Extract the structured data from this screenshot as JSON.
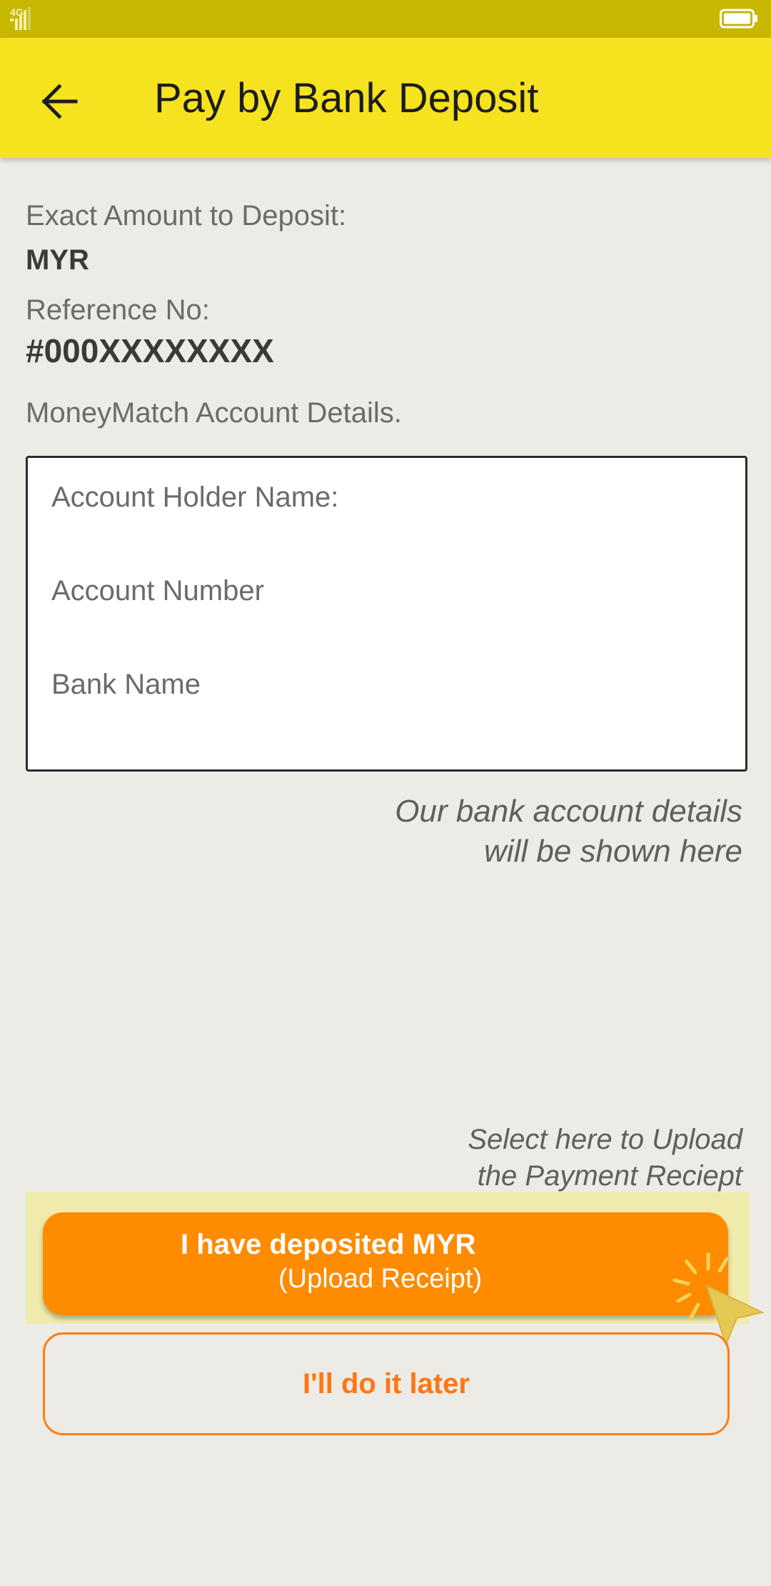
{
  "status_bar": {
    "network_label": "4G",
    "signal_icon": "signal-icon",
    "battery_icon": "battery-icon"
  },
  "header": {
    "back_icon": "arrow-left-icon",
    "title": "Pay by Bank Deposit"
  },
  "deposit": {
    "amount_label": "Exact Amount to Deposit:",
    "amount_value": "MYR",
    "reference_label": "Reference No:",
    "reference_value": "#000XXXXXXXX",
    "account_section_label": "MoneyMatch Account Details."
  },
  "account_box": {
    "holder_name_label": "Account Holder Name:",
    "account_number_label": "Account Number",
    "bank_name_label": "Bank Name"
  },
  "hints": {
    "account_hint_line1": "Our bank account details",
    "account_hint_line2": "will be shown here",
    "upload_hint_line1": "Select here to Upload",
    "upload_hint_line2": "the Payment Reciept"
  },
  "buttons": {
    "deposited_label": "I have deposited MYR",
    "deposited_sublabel": "(Upload Receipt)",
    "later_label": "I'll do it later"
  },
  "colors": {
    "status_bar": "#c7b701",
    "app_bar": "#f6e31f",
    "background": "#ecebe5",
    "primary_button": "#ff8b00",
    "secondary_button_border": "#ff7d12",
    "highlight": "#f1ebab"
  },
  "icons": {
    "tap_cursor": "tap-cursor-icon"
  }
}
